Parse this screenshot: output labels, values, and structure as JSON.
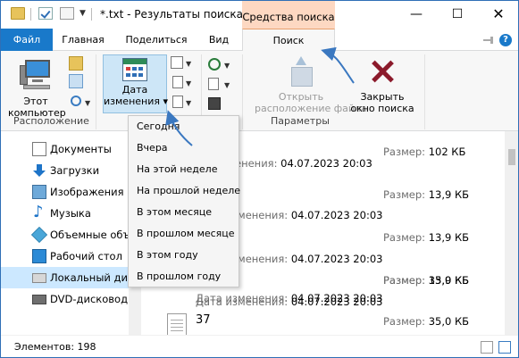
{
  "window": {
    "title": "*.txt - Результаты поиска в ...",
    "context_group": "Средства поиска",
    "minimize": "—",
    "maximize": "☐",
    "close": "✕"
  },
  "tabs": {
    "file": "Файл",
    "home": "Главная",
    "share": "Поделиться",
    "view": "Вид",
    "search": "Поиск",
    "help": "?"
  },
  "ribbon": {
    "this_pc_label": "Этот компьютер",
    "this_pc_line1": "Этот",
    "this_pc_line2": "компьютер",
    "location_group": "Расположение",
    "date_line1": "Дата",
    "date_line2": "изменения",
    "open_line1": "Открыть",
    "open_line2": "расположение файла",
    "close_line1": "Закрыть",
    "close_line2": "окно поиска",
    "params_group": "Параметры"
  },
  "date_menu": {
    "items": [
      "Сегодня",
      "Вчера",
      "На этой неделе",
      "На прошлой неделе",
      "В этом месяце",
      "В прошлом месяце",
      "В этом году",
      "В прошлом году"
    ]
  },
  "nav": {
    "items": [
      "Документы",
      "Загрузки",
      "Изображения",
      "Музыка",
      "Объемные объекты",
      "Рабочий стол",
      "Локальный диск",
      "DVD-дисковод (D:)"
    ]
  },
  "files": {
    "date_label": "Дата изменения:",
    "size_label": "Размер:",
    "rows": [
      {
        "name": "",
        "date": "",
        "size": "102 КБ"
      },
      {
        "name": "",
        "date": "04.07.2023 20:03",
        "size": "13,9 КБ"
      },
      {
        "name": "",
        "date": "04.07.2023 20:03",
        "size": "13,9 КБ"
      },
      {
        "name": "",
        "date": "04.07.2023 20:03",
        "size": "13,9 КБ"
      },
      {
        "name": "",
        "date": "04.07.2023 20:03",
        "size": "35,0 КБ"
      },
      {
        "name": "37",
        "date": "",
        "size": "35,0 КБ"
      }
    ],
    "first_date": "04.07.2023 20:03",
    "first_date_prefix": "енения:"
  },
  "status": {
    "items_label": "Элементов: 198"
  },
  "colors": {
    "accent": "#1979ca",
    "context_tab": "#fdd8c2",
    "arrow": "#3b78c0"
  }
}
